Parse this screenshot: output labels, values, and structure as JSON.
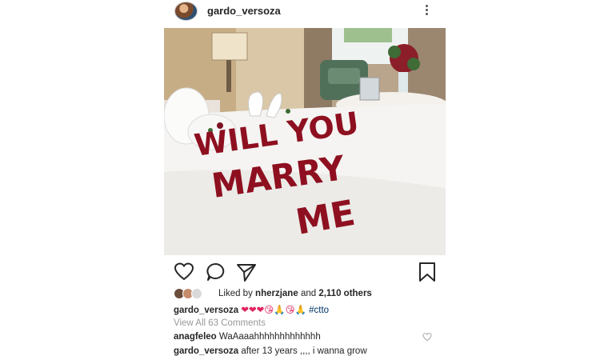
{
  "post": {
    "username": "gardo_versoza",
    "photo": {
      "words": [
        "WILL YOU",
        "MARRY",
        "ME"
      ]
    },
    "likes": {
      "prefix": "Liked by",
      "first_user": "nherzjane",
      "connector": "and",
      "others": "2,110 others"
    },
    "caption": {
      "username": "gardo_versoza",
      "emojis": "❤❤❤😘🙏😘🙏",
      "hashtag": "#ctto"
    },
    "view_all": "View All 63 Comments",
    "comments": [
      {
        "username": "anagfeleo",
        "text": "WaAaaahhhhhhhhhhhhh"
      },
      {
        "username": "gardo_versoza",
        "text": "after  13 years ,,,, i wanna grow"
      }
    ]
  },
  "colors": {
    "heart_red": "#e0245e",
    "hashtag_blue": "#003569",
    "muted_gray": "#999999",
    "petal_red": "#8e1020"
  }
}
